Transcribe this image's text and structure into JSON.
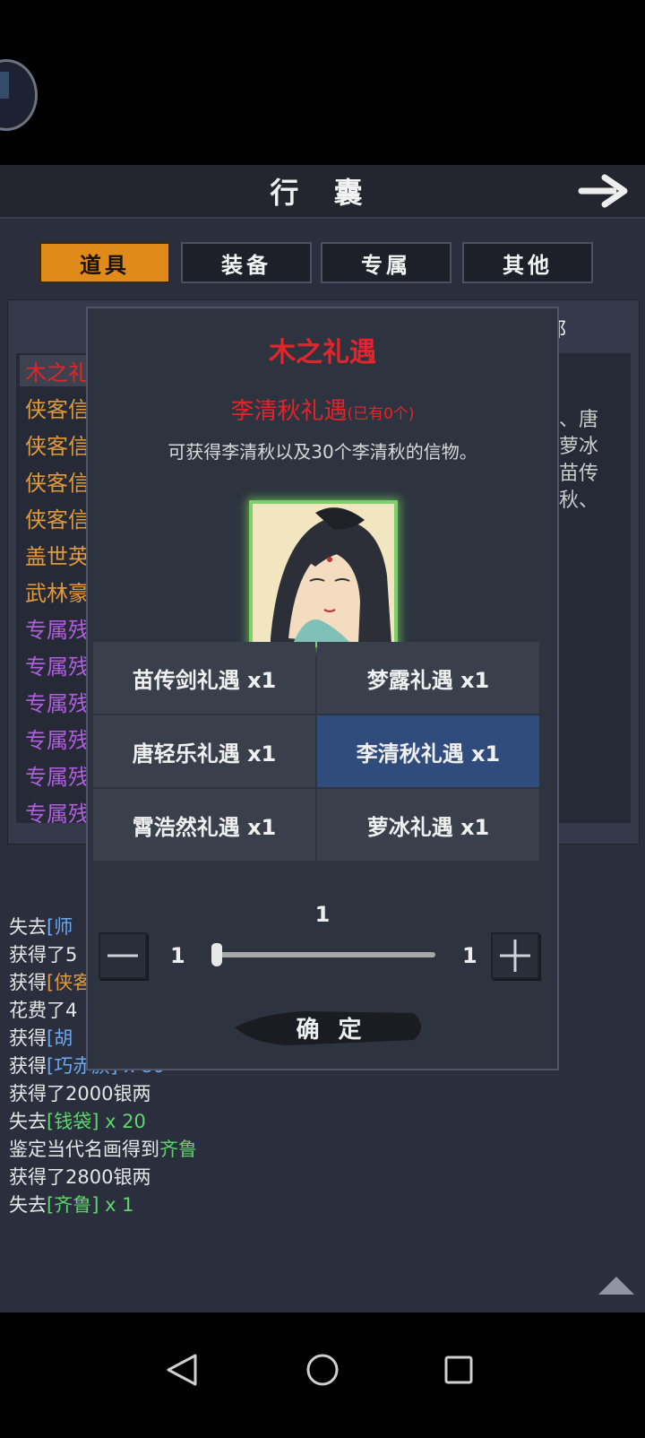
{
  "header": {
    "title": "行 囊"
  },
  "tabs": [
    {
      "label": "道具",
      "active": true
    },
    {
      "label": "装备",
      "active": false
    },
    {
      "label": "专属",
      "active": false
    },
    {
      "label": "其他",
      "active": false
    }
  ],
  "item_list": [
    {
      "text": "木之礼",
      "color": "#e0262a"
    },
    {
      "text": "侠客信",
      "color": "#e09a3a"
    },
    {
      "text": "侠客信",
      "color": "#e09a3a"
    },
    {
      "text": "侠客信",
      "color": "#e09a3a"
    },
    {
      "text": "侠客信",
      "color": "#e09a3a"
    },
    {
      "text": "盖世英",
      "color": "#e09a3a"
    },
    {
      "text": "武林豪",
      "color": "#e09a3a"
    },
    {
      "text": "专属残",
      "color": "#b05de0"
    },
    {
      "text": "专属残",
      "color": "#b05de0"
    },
    {
      "text": "专属残",
      "color": "#b05de0"
    },
    {
      "text": "专属残",
      "color": "#b05de0"
    },
    {
      "text": "专属残",
      "color": "#b05de0"
    },
    {
      "text": "专属残",
      "color": "#b05de0"
    }
  ],
  "description_fragment": {
    "header": "邪",
    "lines": [
      "、唐",
      "萝冰",
      "苗传",
      "秋、"
    ]
  },
  "modal": {
    "title": "木之礼遇",
    "subtitle_name": "李清秋礼遇",
    "subtitle_owned": "(已有0个)",
    "description": "可获得李清秋以及30个李清秋的信物。",
    "portrait_icon": "li-qingqiu-portrait",
    "rewards": [
      {
        "label": "苗传剑礼遇 x1",
        "selected": false
      },
      {
        "label": "梦露礼遇 x1",
        "selected": false
      },
      {
        "label": "唐轻乐礼遇 x1",
        "selected": false
      },
      {
        "label": "李清秋礼遇 x1",
        "selected": true
      },
      {
        "label": "霄浩然礼遇 x1",
        "selected": false
      },
      {
        "label": "萝冰礼遇 x1",
        "selected": false
      }
    ],
    "quantity": {
      "current": "1",
      "min": "1",
      "max": "1",
      "fraction": 0
    },
    "confirm_label": "确 定"
  },
  "log": [
    {
      "parts": [
        {
          "t": "失去",
          "c": ""
        },
        {
          "t": "[师",
          "c": "c-blue"
        }
      ]
    },
    {
      "parts": [
        {
          "t": "获得了5",
          "c": ""
        }
      ]
    },
    {
      "parts": [
        {
          "t": "获得",
          "c": ""
        },
        {
          "t": "[侠客",
          "c": "c-orange"
        }
      ]
    },
    {
      "parts": [
        {
          "t": "花费了4",
          "c": ""
        }
      ]
    },
    {
      "parts": [
        {
          "t": "获得",
          "c": ""
        },
        {
          "t": "[胡",
          "c": "c-blue"
        }
      ]
    },
    {
      "parts": [
        {
          "t": "获得",
          "c": ""
        },
        {
          "t": "[巧赤旗]",
          "c": "c-blue"
        },
        {
          "t": " x 80",
          "c": "c-blue"
        }
      ]
    },
    {
      "parts": [
        {
          "t": "获得了2000银两",
          "c": ""
        }
      ]
    },
    {
      "parts": [
        {
          "t": "失去",
          "c": ""
        },
        {
          "t": "[钱袋]",
          "c": "c-green"
        },
        {
          "t": " x 20",
          "c": "c-green"
        }
      ]
    },
    {
      "parts": [
        {
          "t": "鉴定当代名画得到",
          "c": ""
        },
        {
          "t": "齐鲁",
          "c": "c-green"
        }
      ]
    },
    {
      "parts": [
        {
          "t": "获得了2800银两",
          "c": ""
        }
      ]
    },
    {
      "parts": [
        {
          "t": "失去",
          "c": ""
        },
        {
          "t": "[齐鲁]",
          "c": "c-green"
        },
        {
          "t": " x 1",
          "c": "c-green"
        }
      ]
    }
  ],
  "icons": {
    "back_arrow": "arrow-right-icon",
    "minus": "minus-icon",
    "plus": "plus-icon",
    "scroll_up": "triangle-up-icon",
    "nav_back": "nav-back-icon",
    "nav_home": "nav-home-icon",
    "nav_recent": "nav-recent-icon"
  },
  "colors": {
    "active_tab": "#e08a1a",
    "title_red": "#e0262a",
    "selected_reward": "#2f4c7c",
    "portrait_border": "#7fd06a"
  }
}
